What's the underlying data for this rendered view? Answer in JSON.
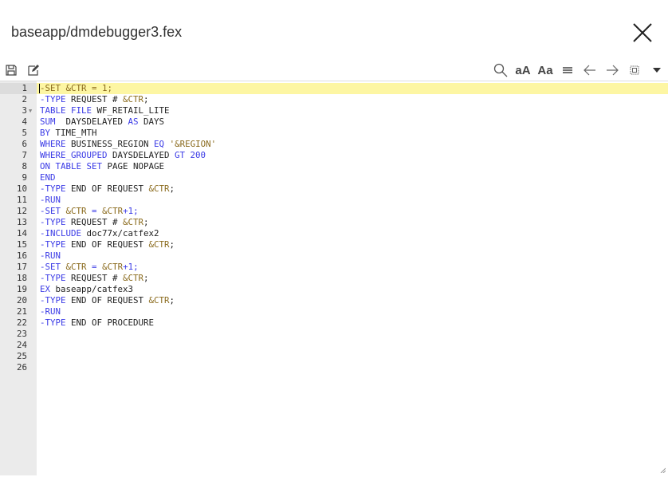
{
  "title": "baseapp/dmdebugger3.fex",
  "toolbar_left": [
    {
      "icon": "save-icon"
    },
    {
      "icon": "edit-icon"
    }
  ],
  "toolbar_right": [
    {
      "icon": "search-icon"
    },
    {
      "icon": "font-size-icon"
    },
    {
      "icon": "case-icon"
    },
    {
      "icon": "list-icon"
    },
    {
      "icon": "arrow-left-icon"
    },
    {
      "icon": "arrow-right-icon"
    },
    {
      "icon": "select-all-icon"
    },
    {
      "icon": "caret-down-icon"
    }
  ],
  "active_line": 1,
  "lines": [
    [
      [
        "-SET &CTR = 1;",
        "v"
      ]
    ],
    [
      [
        "-TYPE",
        "k"
      ],
      [
        " REQUEST # ",
        "p"
      ],
      [
        "&CTR",
        "v"
      ],
      [
        ";",
        "p"
      ]
    ],
    [
      [
        "TABLE FILE",
        "k"
      ],
      [
        " WF_RETAIL_LITE",
        "p"
      ]
    ],
    [
      [
        "SUM",
        "k"
      ],
      [
        "  DAYSDELAYED ",
        "p"
      ],
      [
        "AS",
        "k"
      ],
      [
        " DAYS",
        "p"
      ]
    ],
    [
      [
        "BY",
        "k"
      ],
      [
        " TIME_MTH",
        "p"
      ]
    ],
    [
      [
        "WHERE",
        "k"
      ],
      [
        " BUSINESS_REGION ",
        "p"
      ],
      [
        "EQ",
        "k"
      ],
      [
        " ",
        "p"
      ],
      [
        "'&REGION'",
        "s"
      ]
    ],
    [
      [
        "WHERE_GROUPED",
        "k"
      ],
      [
        " DAYSDELAYED ",
        "p"
      ],
      [
        "GT 200",
        "k"
      ]
    ],
    [
      [
        "ON TABLE SET",
        "k"
      ],
      [
        " PAGE NOPAGE",
        "p"
      ]
    ],
    [
      [
        "END",
        "k"
      ]
    ],
    [
      [
        "-TYPE",
        "k"
      ],
      [
        " END OF REQUEST ",
        "p"
      ],
      [
        "&CTR",
        "v"
      ],
      [
        ";",
        "p"
      ]
    ],
    [
      [
        "-RUN",
        "k"
      ]
    ],
    [
      [
        "-SET",
        "k"
      ],
      [
        " ",
        "p"
      ],
      [
        "&CTR",
        "v"
      ],
      [
        " = ",
        "k"
      ],
      [
        "&CTR",
        "v"
      ],
      [
        "+1;",
        "k"
      ]
    ],
    [
      [
        "-TYPE",
        "k"
      ],
      [
        " REQUEST # ",
        "p"
      ],
      [
        "&CTR",
        "v"
      ],
      [
        ";",
        "p"
      ]
    ],
    [
      [
        "-INCLUDE",
        "k"
      ],
      [
        " doc77x/catfex2",
        "p"
      ]
    ],
    [
      [
        "-TYPE",
        "k"
      ],
      [
        " END OF REQUEST ",
        "p"
      ],
      [
        "&CTR",
        "v"
      ],
      [
        ";",
        "p"
      ]
    ],
    [
      [
        "-RUN",
        "k"
      ]
    ],
    [
      [
        "-SET",
        "k"
      ],
      [
        " ",
        "p"
      ],
      [
        "&CTR",
        "v"
      ],
      [
        " = ",
        "k"
      ],
      [
        "&CTR",
        "v"
      ],
      [
        "+1;",
        "k"
      ]
    ],
    [
      [
        "-TYPE",
        "k"
      ],
      [
        " REQUEST # ",
        "p"
      ],
      [
        "&CTR",
        "v"
      ],
      [
        ";",
        "p"
      ]
    ],
    [
      [
        "EX",
        "k"
      ],
      [
        " baseapp/catfex3",
        "p"
      ]
    ],
    [
      [
        "-TYPE",
        "k"
      ],
      [
        " END OF REQUEST ",
        "p"
      ],
      [
        "&CTR",
        "v"
      ],
      [
        ";",
        "p"
      ]
    ],
    [
      [
        "-RUN",
        "k"
      ]
    ],
    [
      [
        "-TYPE",
        "k"
      ],
      [
        " END OF PROCEDURE",
        "p"
      ]
    ],
    [],
    [],
    [],
    []
  ]
}
